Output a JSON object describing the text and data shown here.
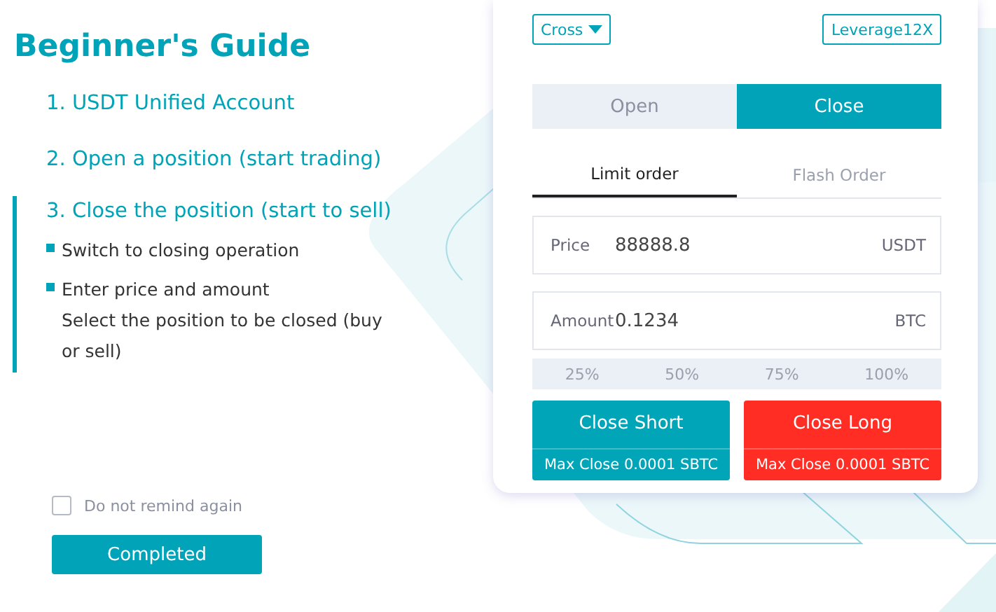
{
  "guide": {
    "title": "Beginner's Guide",
    "steps": [
      {
        "label": "1. USDT Unified Account",
        "selected": false
      },
      {
        "label": "2. Open a position (start trading)",
        "selected": false
      },
      {
        "label": "3. Close the position (start to sell)",
        "selected": true,
        "bullets": [
          {
            "lines": [
              "Switch to closing operation"
            ]
          },
          {
            "lines": [
              "Enter price and amount",
              "Select the position to be closed (buy or sell)"
            ]
          }
        ]
      }
    ]
  },
  "remind": {
    "label": "Do not remind again",
    "checked": false
  },
  "completed_button": "Completed",
  "panel": {
    "margin_mode": "Cross",
    "leverage": "Leverage12X",
    "side_tabs": [
      {
        "label": "Open",
        "selected": false
      },
      {
        "label": "Close",
        "selected": true
      }
    ],
    "order_tabs": [
      {
        "label": "Limit order",
        "selected": true
      },
      {
        "label": "Flash Order",
        "selected": false
      }
    ],
    "fields": [
      {
        "label": "Price",
        "value": "88888.8",
        "unit": "USDT"
      },
      {
        "label": "Amount",
        "value": "0.1234",
        "unit": "BTC"
      }
    ],
    "percents": [
      "25%",
      "50%",
      "75%",
      "100%"
    ],
    "actions": [
      {
        "kind": "short",
        "title": "Close Short",
        "subtitle": "Max Close 0.0001 SBTC"
      },
      {
        "kind": "long",
        "title": "Close Long",
        "subtitle": "Max Close 0.0001 SBTC"
      }
    ]
  }
}
